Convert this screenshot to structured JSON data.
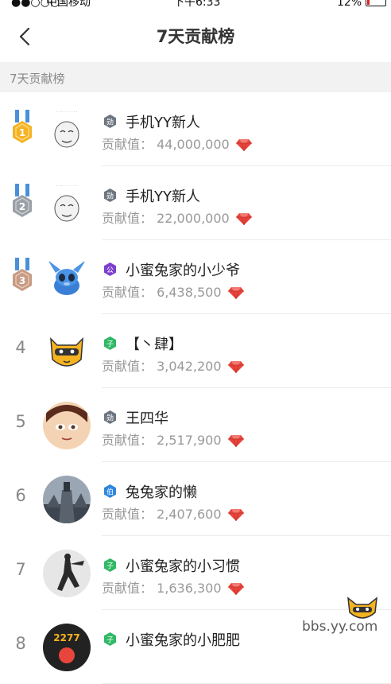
{
  "status_bar": {
    "signal": "●●○○○",
    "carrier": "中国移动",
    "time": "下午6:33",
    "battery": "12%"
  },
  "nav": {
    "title": "7天贡献榜"
  },
  "section": {
    "title": "7天贡献榜"
  },
  "list": {
    "contrib_label": "贡献值：",
    "items": [
      {
        "rank": "1",
        "medal": "gold",
        "badge_char": "勋",
        "badge_color": "#6d7580",
        "name": "手机YY新人",
        "value": "44,000,000"
      },
      {
        "rank": "2",
        "medal": "silver",
        "badge_char": "勋",
        "badge_color": "#6d7580",
        "name": "手机YY新人",
        "value": "22,000,000"
      },
      {
        "rank": "3",
        "medal": "bronze",
        "badge_char": "公",
        "badge_color": "#7c3fd0",
        "name": "小蜜兔家的小少爷",
        "value": "6,438,500"
      },
      {
        "rank": "4",
        "medal": "",
        "badge_char": "子",
        "badge_color": "#2fb865",
        "name": "【丶肆】",
        "value": "3,042,200"
      },
      {
        "rank": "5",
        "medal": "",
        "badge_char": "勋",
        "badge_color": "#6d7580",
        "name": "王四华",
        "value": "2,517,900"
      },
      {
        "rank": "6",
        "medal": "",
        "badge_char": "伯",
        "badge_color": "#2e86de",
        "name": "兔兔家的懒",
        "value": "2,407,600"
      },
      {
        "rank": "7",
        "medal": "",
        "badge_char": "子",
        "badge_color": "#2fb865",
        "name": "小蜜兔家的小习惯",
        "value": "1,636,300"
      },
      {
        "rank": "8",
        "medal": "",
        "badge_char": "子",
        "badge_color": "#2fb865",
        "name": "小蜜兔家的小肥肥",
        "value": ""
      }
    ]
  },
  "colors": {
    "gem": "#e8453c",
    "gold": "#f5b321",
    "silver": "#9aa0a6",
    "bronze": "#c89a82"
  },
  "watermark": {
    "text": "bbs.yy.com"
  }
}
